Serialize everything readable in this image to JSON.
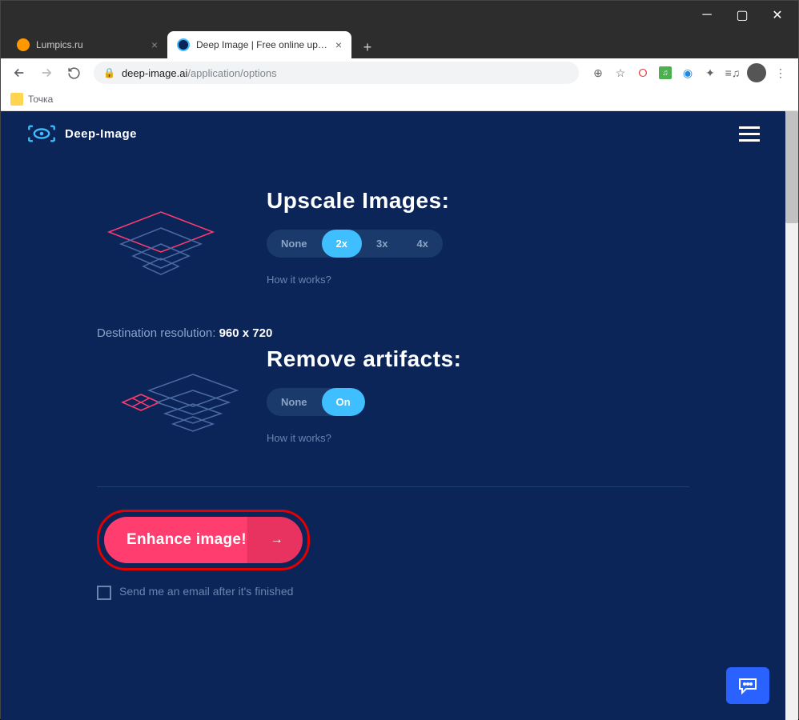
{
  "window": {
    "tabs": [
      {
        "title": "Lumpics.ru",
        "active": false
      },
      {
        "title": "Deep Image | Free online upscale",
        "active": true
      }
    ],
    "url_domain": "deep-image.ai",
    "url_path": "/application/options"
  },
  "bookmarks": [
    {
      "label": "Точка"
    }
  ],
  "site": {
    "brand": "Deep-Image"
  },
  "upscale": {
    "title": "Upscale Images:",
    "options": [
      "None",
      "2x",
      "3x",
      "4x"
    ],
    "selected": "2x",
    "how": "How it works?"
  },
  "resolution": {
    "label": "Destination resolution:",
    "value": "960 x 720"
  },
  "artifacts": {
    "title": "Remove artifacts:",
    "options": [
      "None",
      "On"
    ],
    "selected": "On",
    "how": "How it works?"
  },
  "cta": {
    "label": "Enhance image!"
  },
  "email": {
    "label": "Send me an email after it's finished"
  }
}
